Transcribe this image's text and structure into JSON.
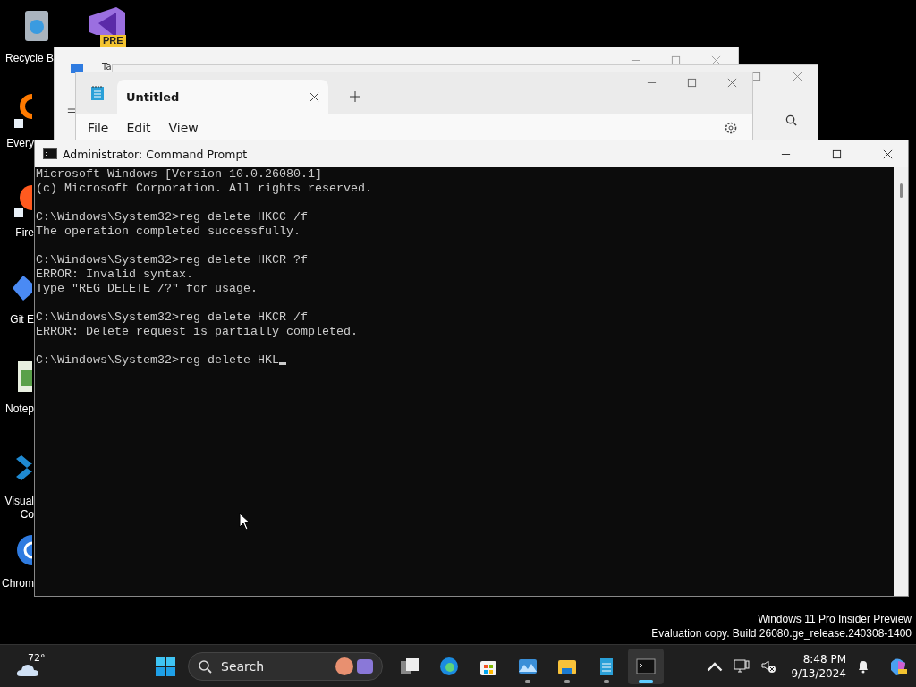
{
  "desktop_icons": [
    {
      "kind": "recycle",
      "label": [
        "Recycle B"
      ]
    },
    {
      "kind": "search",
      "label": [
        "Every"
      ]
    },
    {
      "kind": "fox",
      "label": [
        "Fire"
      ]
    },
    {
      "kind": "git",
      "label": [
        "Git E"
      ]
    },
    {
      "kind": "notepad",
      "label": [
        "Notep"
      ]
    },
    {
      "kind": "code",
      "label": [
        "Visual",
        "Co"
      ]
    },
    {
      "kind": "chrome",
      "label": [
        "Chrom"
      ]
    },
    {
      "kind": "studio",
      "badge": "PRE"
    }
  ],
  "back_window": {
    "title": "Ta"
  },
  "notepad": {
    "tab": "Untitled",
    "menu": [
      "File",
      "Edit",
      "View"
    ]
  },
  "cmd": {
    "title": "Administrator: Command Prompt",
    "blocks": [
      [
        "Microsoft Windows [Version 10.0.26080.1]",
        "(c) Microsoft Corporation. All rights reserved."
      ],
      [
        "C:\\Windows\\System32>reg delete HKCC /f",
        "The operation completed successfully."
      ],
      [
        "C:\\Windows\\System32>reg delete HKCR ?f",
        "ERROR: Invalid syntax.",
        "Type \"REG DELETE /?\" for usage."
      ],
      [
        "C:\\Windows\\System32>reg delete HKCR /f",
        "ERROR: Delete request is partially completed."
      ],
      [
        "C:\\Windows\\System32>reg delete HKL"
      ]
    ]
  },
  "watermark": [
    "Windows 11 Pro Insider Preview",
    "Evaluation copy. Build 26080.ge_release.240308-1400"
  ],
  "taskbar": {
    "weather": "72°",
    "search": {
      "placeholder": "Search"
    },
    "apps": [
      {
        "kind": "task-view",
        "running": false,
        "selected": false
      },
      {
        "kind": "browser",
        "running": false,
        "selected": false
      },
      {
        "kind": "store",
        "running": false,
        "selected": false
      },
      {
        "kind": "photos",
        "running": true,
        "selected": false
      },
      {
        "kind": "folder",
        "running": true,
        "selected": false
      },
      {
        "kind": "notepad",
        "running": true,
        "selected": false
      },
      {
        "kind": "terminal",
        "running": true,
        "selected": true
      }
    ],
    "time": "8:48 PM",
    "date": "9/13/2024"
  }
}
